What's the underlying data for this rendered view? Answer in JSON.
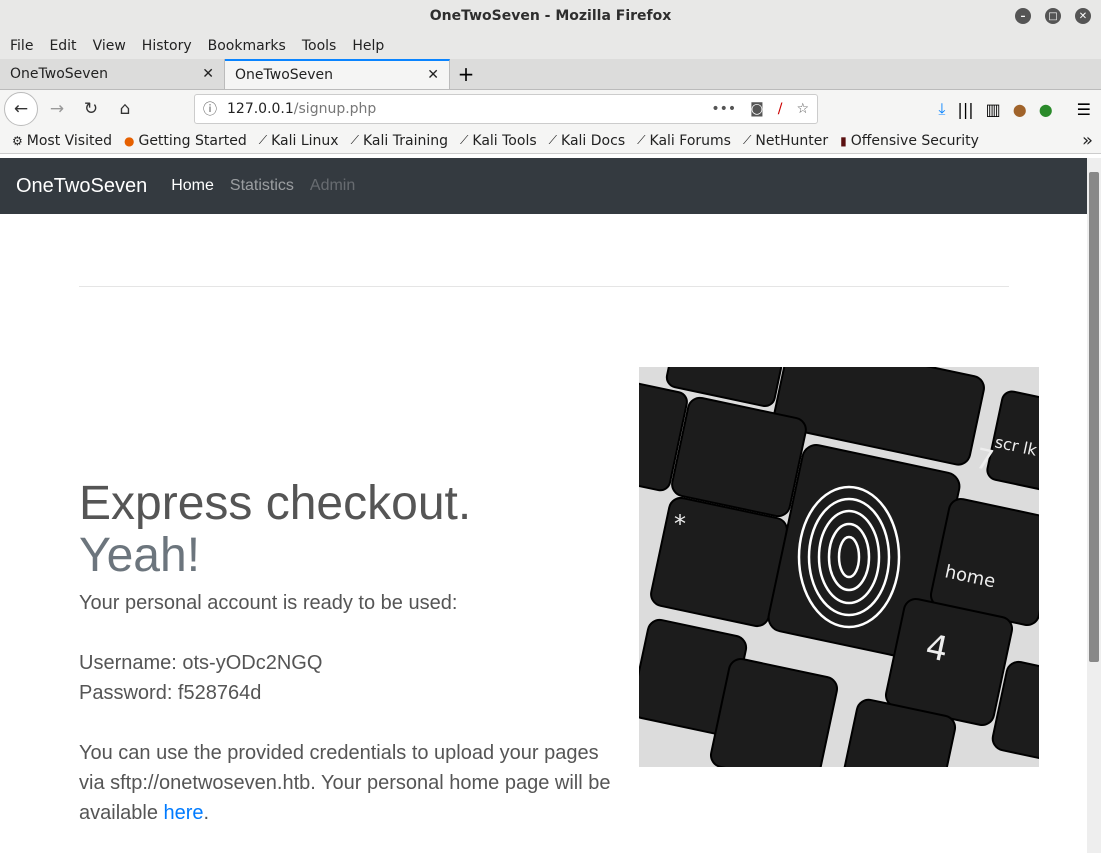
{
  "window": {
    "title": "OneTwoSeven - Mozilla Firefox"
  },
  "menu": [
    "File",
    "Edit",
    "View",
    "History",
    "Bookmarks",
    "Tools",
    "Help"
  ],
  "tabs": [
    {
      "label": "OneTwoSeven"
    },
    {
      "label": "OneTwoSeven",
      "active": true
    }
  ],
  "url": {
    "host": "127.0.0.1",
    "path": "/signup.php"
  },
  "bookmarks": [
    "Most Visited",
    "Getting Started",
    "Kali Linux",
    "Kali Training",
    "Kali Tools",
    "Kali Docs",
    "Kali Forums",
    "NetHunter",
    "Offensive Security"
  ],
  "site": {
    "brand": "OneTwoSeven",
    "nav": [
      "Home",
      "Statistics",
      "Admin"
    ]
  },
  "content": {
    "heading1": "Express checkout.",
    "heading2": "Yeah!",
    "intro": "Your personal account is ready to be used:",
    "username": "Username: ots-yODc2NGQ",
    "password": "Password: f528764d",
    "info": "You can use the provided credentials to upload your pages via sftp://onetwoseven.htb. Your personal home page will be available ",
    "link": "here",
    "end": "."
  },
  "colors": {
    "navbar": "#343a40",
    "link": "#007bff",
    "tab_accent": "#0a84ff"
  }
}
